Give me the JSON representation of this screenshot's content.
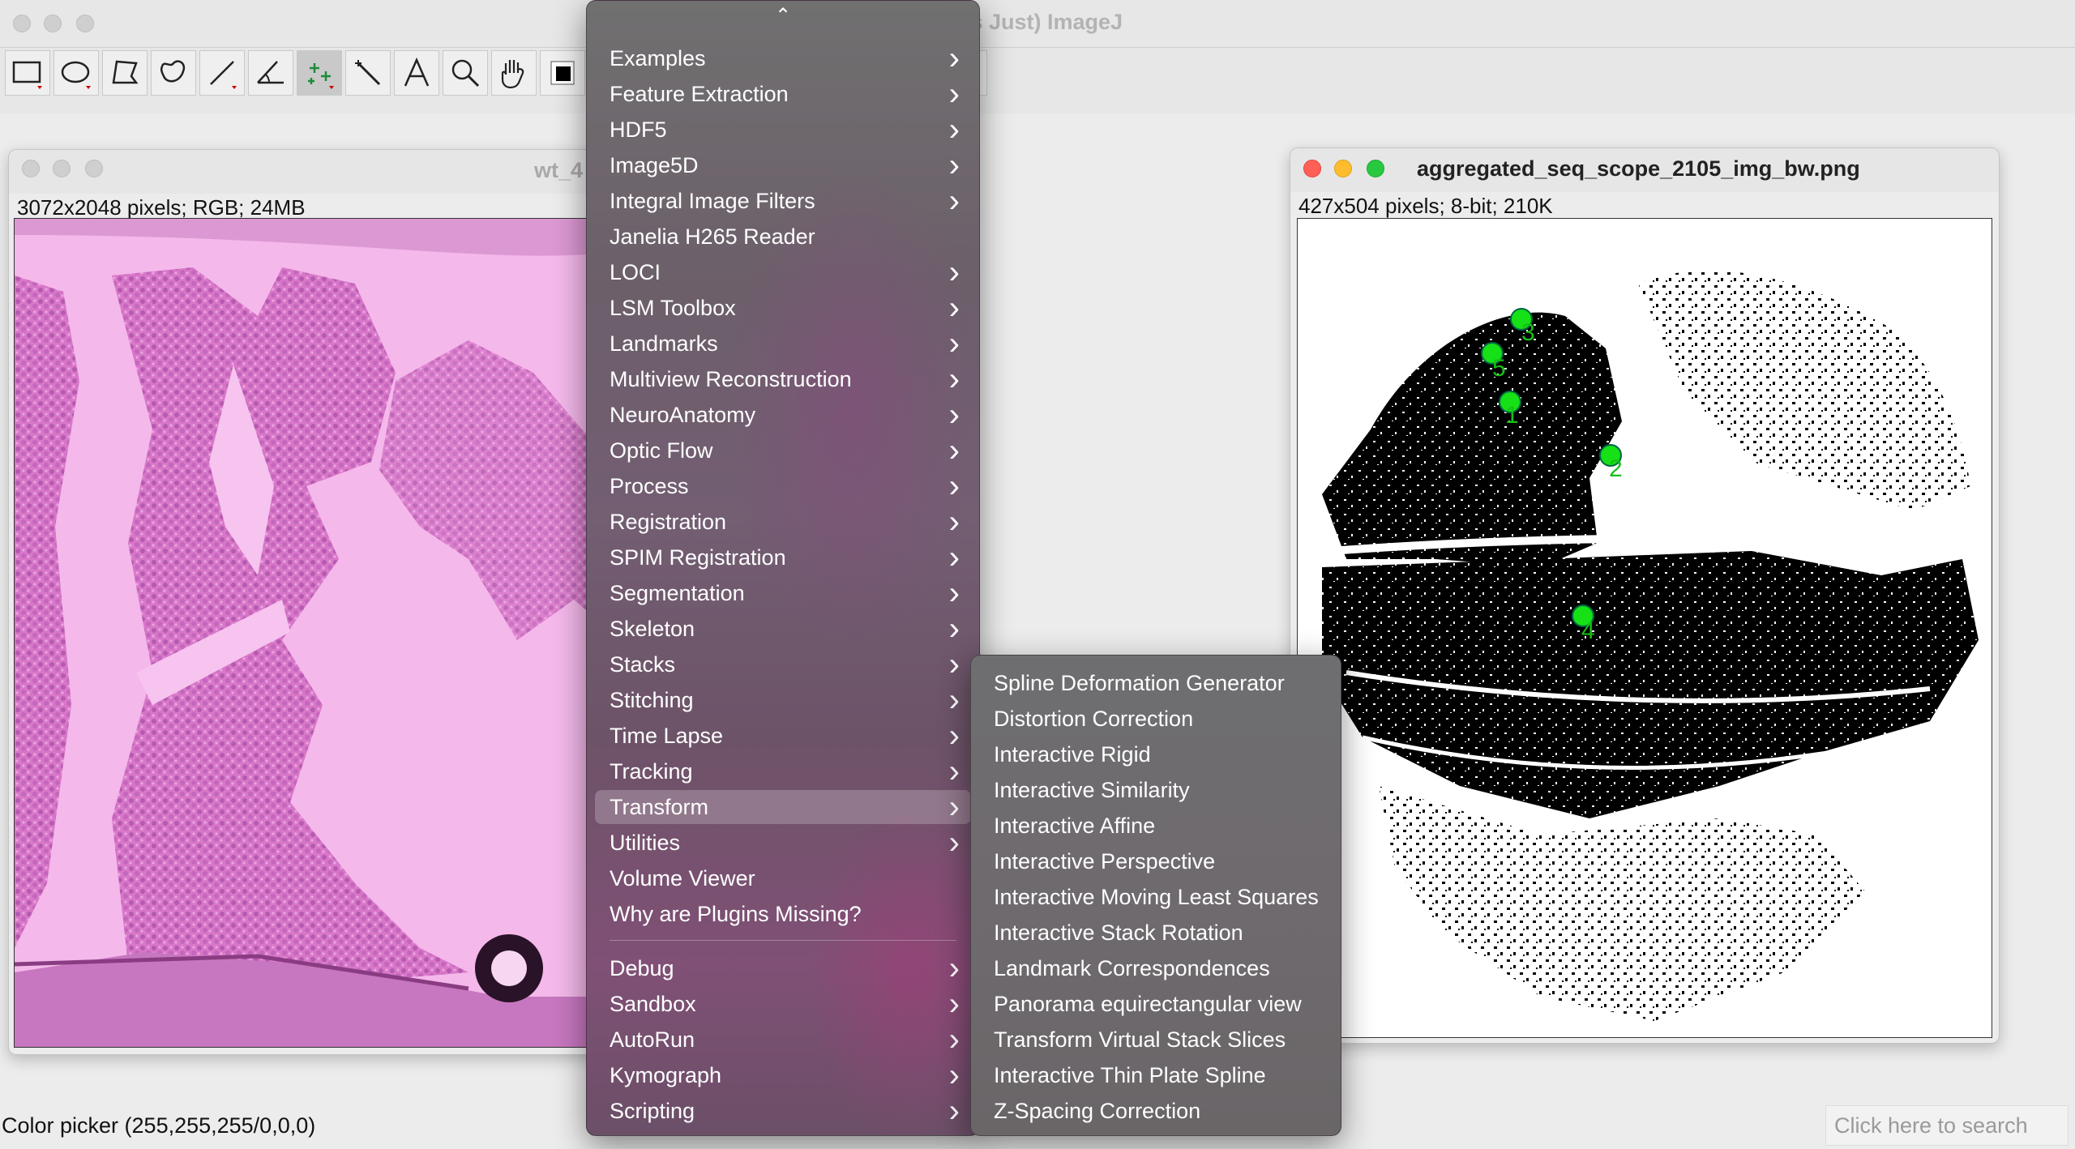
{
  "main_window": {
    "title": "ls Just) ImageJ",
    "tools": [
      "rectangle-tool",
      "oval-tool",
      "polygon-tool",
      "freehand-tool",
      "line-tool",
      "angle-tool",
      "point-tool",
      "wand-tool",
      "text-tool",
      "zoom-tool",
      "hand-tool",
      "color-picker-tool"
    ]
  },
  "left_image": {
    "title": "wt_4",
    "info": "3072x2048 pixels; RGB; 24MB"
  },
  "right_image": {
    "title": "aggregated_seq_scope_2105_img_bw.png",
    "info": "427x504 pixels; 8-bit; 210K",
    "landmarks": [
      "1",
      "2",
      "3",
      "4",
      "5"
    ]
  },
  "plugins_menu": {
    "items": [
      {
        "label": "Examples",
        "submenu": true
      },
      {
        "label": "Feature Extraction",
        "submenu": true
      },
      {
        "label": "HDF5",
        "submenu": true
      },
      {
        "label": "Image5D",
        "submenu": true
      },
      {
        "label": "Integral Image Filters",
        "submenu": true
      },
      {
        "label": "Janelia H265 Reader",
        "submenu": false
      },
      {
        "label": "LOCI",
        "submenu": true
      },
      {
        "label": "LSM Toolbox",
        "submenu": true
      },
      {
        "label": "Landmarks",
        "submenu": true
      },
      {
        "label": "Multiview Reconstruction",
        "submenu": true
      },
      {
        "label": "NeuroAnatomy",
        "submenu": true
      },
      {
        "label": "Optic Flow",
        "submenu": true
      },
      {
        "label": "Process",
        "submenu": true
      },
      {
        "label": "Registration",
        "submenu": true
      },
      {
        "label": "SPIM Registration",
        "submenu": true
      },
      {
        "label": "Segmentation",
        "submenu": true
      },
      {
        "label": "Skeleton",
        "submenu": true
      },
      {
        "label": "Stacks",
        "submenu": true
      },
      {
        "label": "Stitching",
        "submenu": true
      },
      {
        "label": "Time Lapse",
        "submenu": true
      },
      {
        "label": "Tracking",
        "submenu": true
      },
      {
        "label": "Transform",
        "submenu": true,
        "highlighted": true
      },
      {
        "label": "Utilities",
        "submenu": true
      },
      {
        "label": "Volume Viewer",
        "submenu": false
      },
      {
        "label": "Why are Plugins Missing?",
        "submenu": false
      }
    ],
    "lower_items": [
      {
        "label": "Debug",
        "submenu": true
      },
      {
        "label": "Sandbox",
        "submenu": true
      },
      {
        "label": "AutoRun",
        "submenu": true
      },
      {
        "label": "Kymograph",
        "submenu": true
      },
      {
        "label": "Scripting",
        "submenu": true
      }
    ]
  },
  "transform_submenu": {
    "items": [
      "Spline Deformation Generator",
      "Distortion Correction",
      "Interactive Rigid",
      "Interactive Similarity",
      "Interactive Affine",
      "Interactive Perspective",
      "Interactive Moving Least Squares",
      "Interactive Stack Rotation",
      "Landmark Correspondences",
      "Panorama equirectangular view",
      "Transform Virtual Stack Slices",
      "Interactive Thin Plate Spline",
      "Z-Spacing Correction"
    ]
  },
  "status_bar": {
    "text": "Color picker (255,255,255/0,0,0)",
    "search_placeholder": "Click here to search"
  },
  "colors": {
    "landmark": "#16e016",
    "tissue_pink": "#e08fd2",
    "highlight": "rgba(255,255,255,0.22)"
  }
}
